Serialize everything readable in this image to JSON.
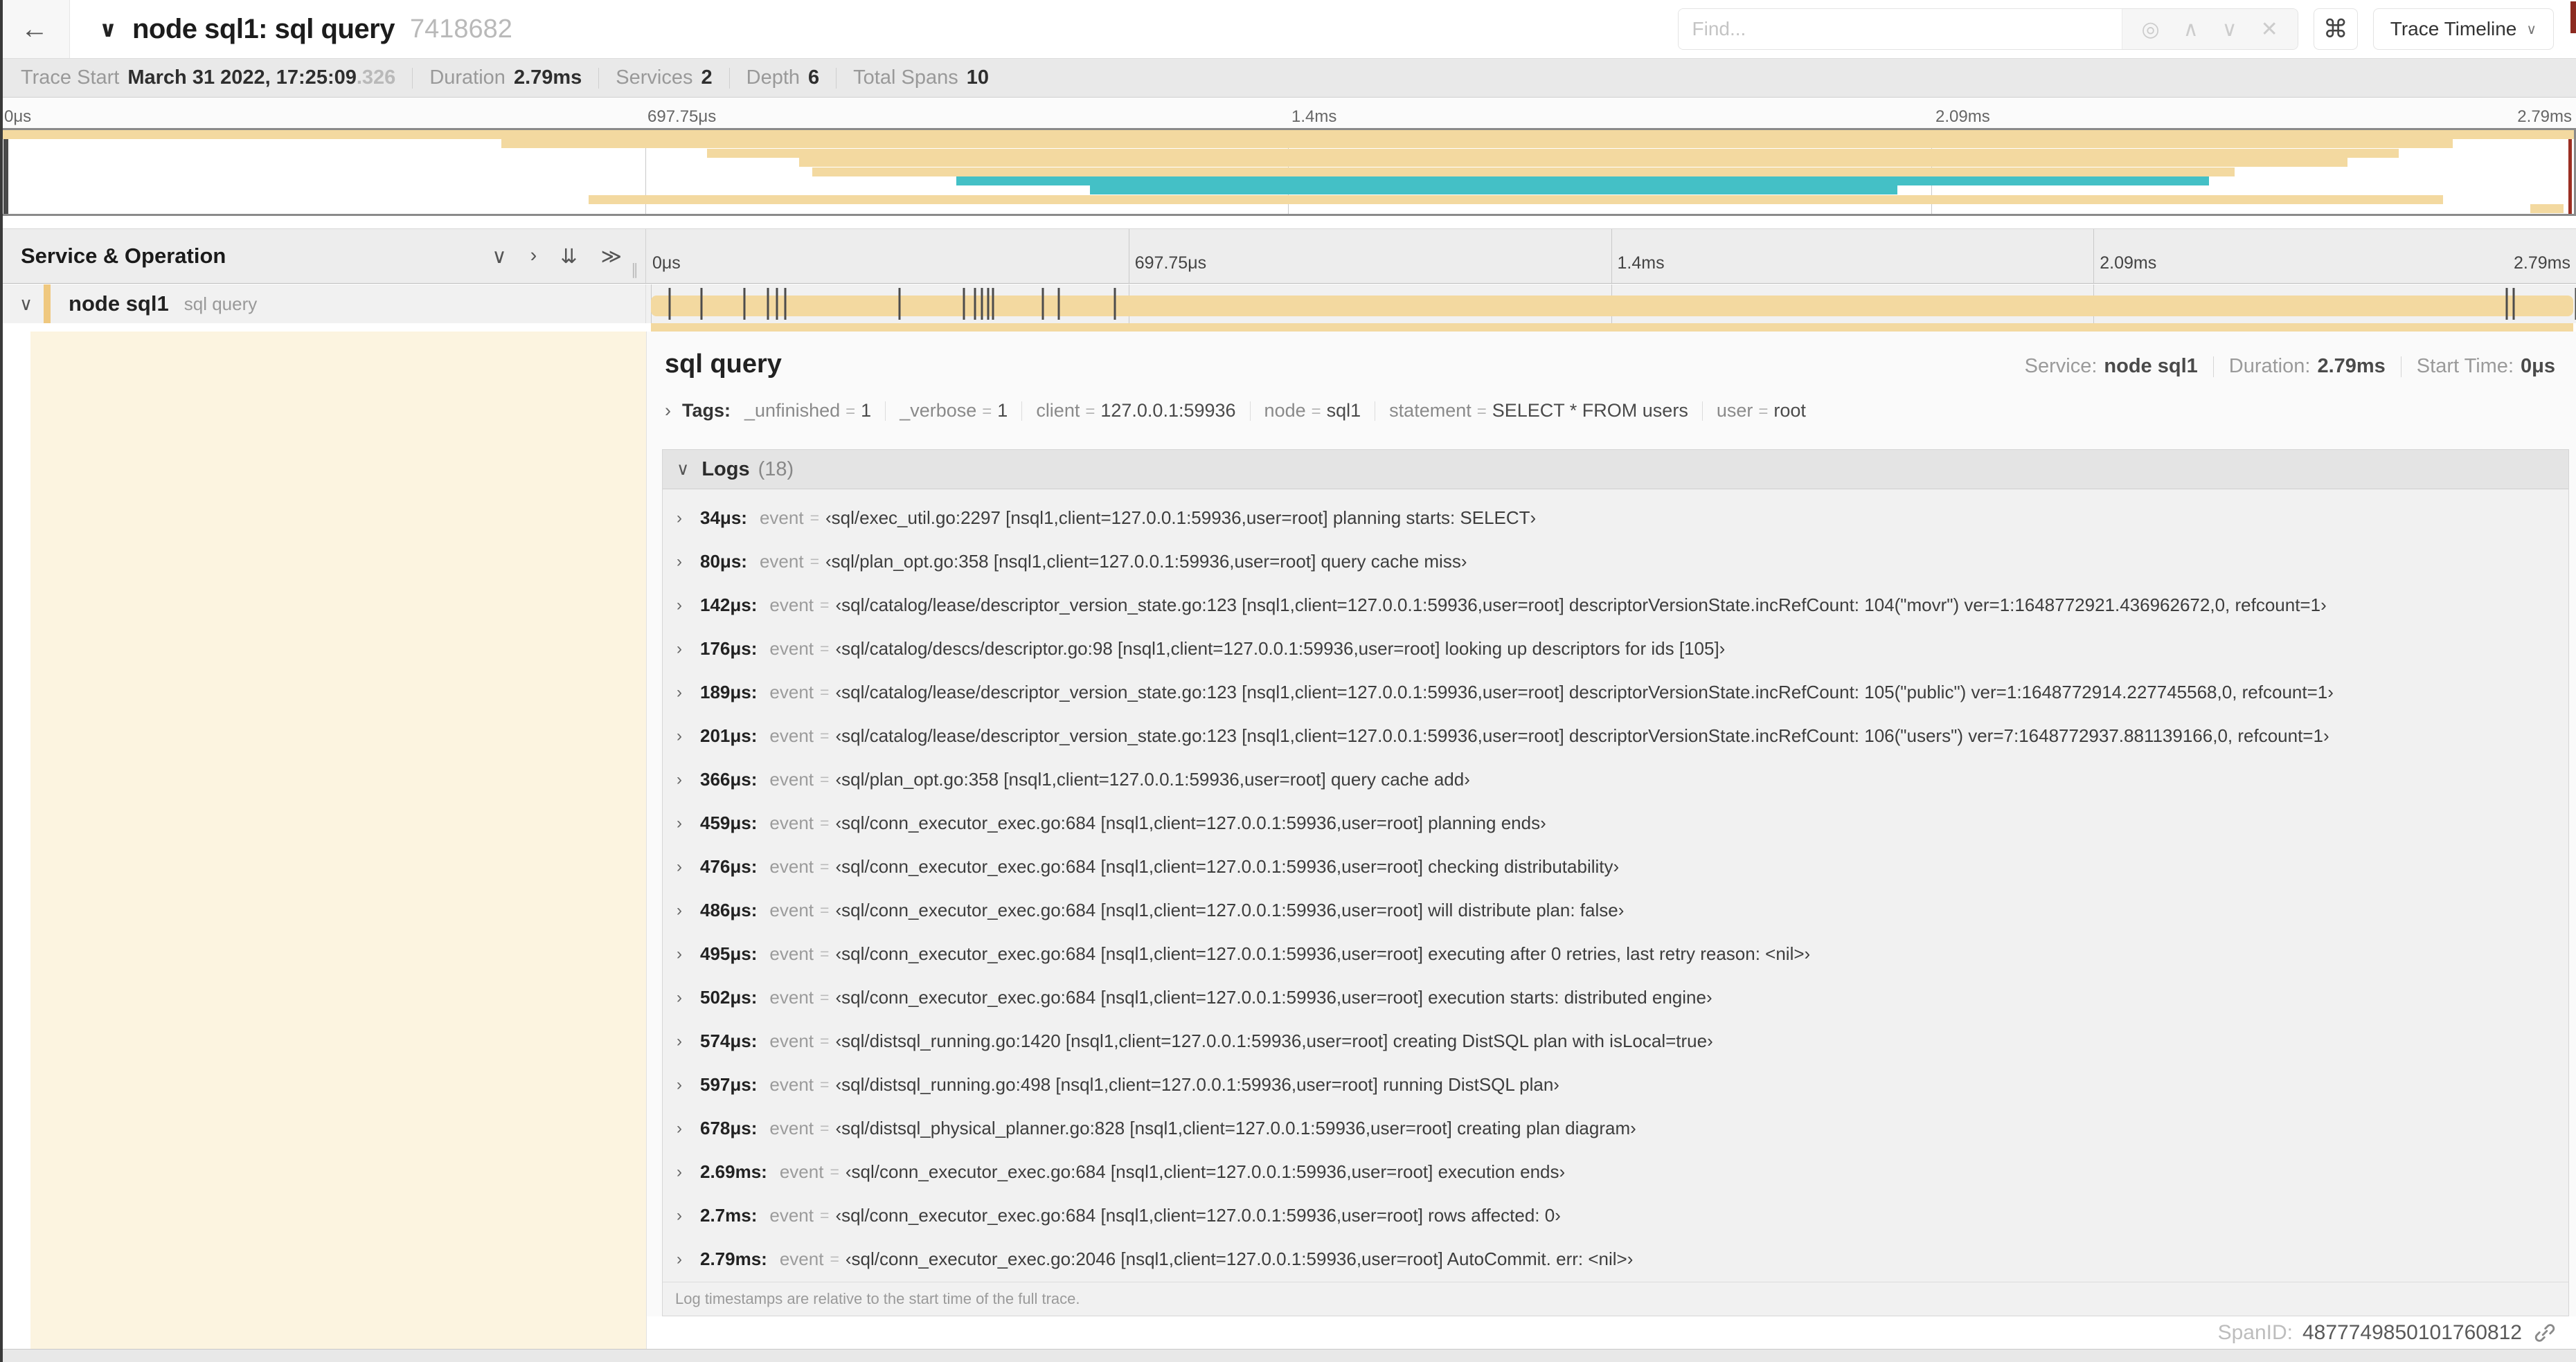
{
  "colors": {
    "span_tan": "#f3d9a0",
    "span_tan_stripe": "#efc87f",
    "span_teal": "#44c0c6",
    "detail_cream": "#fcf4e0"
  },
  "header": {
    "back_icon": "←",
    "collapse_icon": "∨",
    "title": "node sql1: sql query",
    "trace_id": "7418682",
    "find_placeholder": "Find...",
    "find_value": "",
    "find_icons": {
      "target": "◎",
      "prev": "∧",
      "next": "∨",
      "clear": "✕"
    },
    "shortcut_button": "⌘",
    "view_button": "Trace Timeline",
    "view_button_chevron": "∨"
  },
  "trace_info": [
    {
      "label": "Trace Start",
      "value": "March 31 2022, 17:25:09",
      "suffix": ".326"
    },
    {
      "label": "Duration",
      "value": "2.79ms"
    },
    {
      "label": "Services",
      "value": "2"
    },
    {
      "label": "Depth",
      "value": "6"
    },
    {
      "label": "Total Spans",
      "value": "10"
    }
  ],
  "minimap": {
    "ticks": [
      {
        "label": "0μs",
        "f": 0
      },
      {
        "label": "697.75μs",
        "f": 0.25
      },
      {
        "label": "1.4ms",
        "f": 0.5
      },
      {
        "label": "2.09ms",
        "f": 0.75
      },
      {
        "label": "2.79ms",
        "f": 1
      }
    ],
    "spans": [
      {
        "row": 0,
        "l": 0,
        "w": 100,
        "c": "tan"
      },
      {
        "row": 1,
        "l": 19.4,
        "w": 75.9,
        "c": "tan"
      },
      {
        "row": 2,
        "l": 27.4,
        "w": 65.8,
        "c": "tan"
      },
      {
        "row": 3,
        "l": 31.0,
        "w": 60.2,
        "c": "tan"
      },
      {
        "row": 4,
        "l": 31.5,
        "w": 55.3,
        "c": "tan"
      },
      {
        "row": 5,
        "l": 37.1,
        "w": 48.7,
        "c": "teal"
      },
      {
        "row": 6,
        "l": 42.3,
        "w": 31.4,
        "c": "teal"
      },
      {
        "row": 7,
        "l": 22.8,
        "w": 72.1,
        "c": "tan"
      },
      {
        "row": 8,
        "l": 98.3,
        "w": 1.3,
        "c": "tan"
      }
    ]
  },
  "grid_header": {
    "title": "Service & Operation",
    "icons": {
      "collapse_one": "∨",
      "expand_one": "›",
      "collapse_all": "⇊",
      "expand_all": "≫"
    },
    "grip": "∥",
    "ticks": [
      {
        "label": "0μs",
        "f": 0
      },
      {
        "label": "697.75μs",
        "f": 0.25
      },
      {
        "label": "1.4ms",
        "f": 0.5
      },
      {
        "label": "2.09ms",
        "f": 0.75
      },
      {
        "label": "2.79ms",
        "f": 1
      }
    ]
  },
  "span_row": {
    "chevron": "∨",
    "service": "node sql1",
    "operation": "sql query",
    "duration_us": 2790
  },
  "detail": {
    "title": "sql query",
    "stats": [
      {
        "label": "Service:",
        "value": "node sql1"
      },
      {
        "label": "Duration:",
        "value": "2.79ms"
      },
      {
        "label": "Start Time:",
        "value": "0μs"
      }
    ],
    "tags_chevron": "›",
    "tags_label": "Tags:",
    "tags": [
      {
        "key": "_unfinished",
        "value": "1"
      },
      {
        "key": "_verbose",
        "value": "1"
      },
      {
        "key": "client",
        "value": "127.0.0.1:59936"
      },
      {
        "key": "node",
        "value": "sql1"
      },
      {
        "key": "statement",
        "value": "SELECT * FROM users"
      },
      {
        "key": "user",
        "value": "root"
      }
    ],
    "logs": {
      "chevron": "∨",
      "label": "Logs",
      "count": "(18)",
      "row_chevron": "›",
      "key": "event",
      "eq": "=",
      "entries": [
        {
          "t_us": 34,
          "time": "34μs:",
          "value": "‹sql/exec_util.go:2297 [nsql1,client=127.0.0.1:59936,user=root] planning starts: SELECT›"
        },
        {
          "t_us": 80,
          "time": "80μs:",
          "value": "‹sql/plan_opt.go:358 [nsql1,client=127.0.0.1:59936,user=root] query cache miss›"
        },
        {
          "t_us": 142,
          "time": "142μs:",
          "value": "‹sql/catalog/lease/descriptor_version_state.go:123 [nsql1,client=127.0.0.1:59936,user=root] descriptorVersionState.incRefCount: 104(\"movr\") ver=1:1648772921.436962672,0, refcount=1›"
        },
        {
          "t_us": 176,
          "time": "176μs:",
          "value": "‹sql/catalog/descs/descriptor.go:98 [nsql1,client=127.0.0.1:59936,user=root] looking up descriptors for ids [105]›"
        },
        {
          "t_us": 189,
          "time": "189μs:",
          "value": "‹sql/catalog/lease/descriptor_version_state.go:123 [nsql1,client=127.0.0.1:59936,user=root] descriptorVersionState.incRefCount: 105(\"public\") ver=1:1648772914.227745568,0, refcount=1›"
        },
        {
          "t_us": 201,
          "time": "201μs:",
          "value": "‹sql/catalog/lease/descriptor_version_state.go:123 [nsql1,client=127.0.0.1:59936,user=root] descriptorVersionState.incRefCount: 106(\"users\") ver=7:1648772937.881139166,0, refcount=1›"
        },
        {
          "t_us": 366,
          "time": "366μs:",
          "value": "‹sql/plan_opt.go:358 [nsql1,client=127.0.0.1:59936,user=root] query cache add›"
        },
        {
          "t_us": 459,
          "time": "459μs:",
          "value": "‹sql/conn_executor_exec.go:684 [nsql1,client=127.0.0.1:59936,user=root] planning ends›"
        },
        {
          "t_us": 476,
          "time": "476μs:",
          "value": "‹sql/conn_executor_exec.go:684 [nsql1,client=127.0.0.1:59936,user=root] checking distributability›"
        },
        {
          "t_us": 486,
          "time": "486μs:",
          "value": "‹sql/conn_executor_exec.go:684 [nsql1,client=127.0.0.1:59936,user=root] will distribute plan: false›"
        },
        {
          "t_us": 495,
          "time": "495μs:",
          "value": "‹sql/conn_executor_exec.go:684 [nsql1,client=127.0.0.1:59936,user=root] executing after 0 retries, last retry reason: <nil>›"
        },
        {
          "t_us": 502,
          "time": "502μs:",
          "value": "‹sql/conn_executor_exec.go:684 [nsql1,client=127.0.0.1:59936,user=root] execution starts: distributed engine›"
        },
        {
          "t_us": 574,
          "time": "574μs:",
          "value": "‹sql/distsql_running.go:1420 [nsql1,client=127.0.0.1:59936,user=root] creating DistSQL plan with isLocal=true›"
        },
        {
          "t_us": 597,
          "time": "597μs:",
          "value": "‹sql/distsql_running.go:498 [nsql1,client=127.0.0.1:59936,user=root] running DistSQL plan›"
        },
        {
          "t_us": 678,
          "time": "678μs:",
          "value": "‹sql/distsql_physical_planner.go:828 [nsql1,client=127.0.0.1:59936,user=root] creating plan diagram›"
        },
        {
          "t_us": 2690,
          "time": "2.69ms:",
          "value": "‹sql/conn_executor_exec.go:684 [nsql1,client=127.0.0.1:59936,user=root] execution ends›"
        },
        {
          "t_us": 2700,
          "time": "2.7ms:",
          "value": "‹sql/conn_executor_exec.go:684 [nsql1,client=127.0.0.1:59936,user=root] rows affected: 0›"
        },
        {
          "t_us": 2790,
          "time": "2.79ms:",
          "value": "‹sql/conn_executor_exec.go:2046 [nsql1,client=127.0.0.1:59936,user=root] AutoCommit. err: <nil>›"
        }
      ],
      "footer": "Log timestamps are relative to the start time of the full trace."
    },
    "span_id_label": "SpanID:",
    "span_id": "4877749850101760812"
  }
}
